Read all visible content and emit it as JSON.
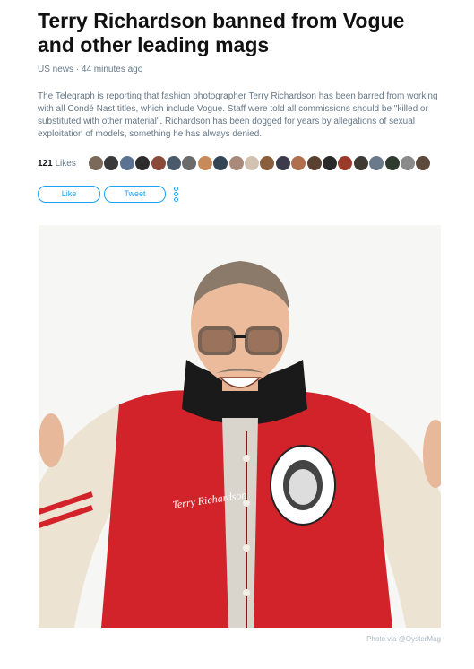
{
  "article": {
    "title": "Terry Richardson banned from Vogue and other leading mags",
    "meta": "US news · 44 minutes ago",
    "body": "The Telegraph is reporting that fashion photographer Terry Richardson has been barred from working with all Condé Nast titles, which include Vogue. Staff were told all commissions should be \"killed or substituted with other material\". Richardson has been dogged for years by allegations of sexual exploitation of models, something he has always denied.",
    "photo_caption": "Photo via @OysterMag",
    "photo_jacket_script": "Terry Richardson"
  },
  "likes": {
    "count": "121",
    "label": "Likes",
    "avatar_colors": [
      "#7b6a5a",
      "#3a3a3a",
      "#5b7390",
      "#2d2d2d",
      "#8a4b3a",
      "#4a5a6a",
      "#6b6b6b",
      "#c98a5a",
      "#334455",
      "#a98a7a",
      "#d2c2b2",
      "#8b5e3c",
      "#3b3b4b",
      "#b07050",
      "#5a4030",
      "#2a2a2a",
      "#9a3a2a",
      "#403a35",
      "#6a7a8a",
      "#2e3b2e",
      "#8a8a8a",
      "#5d4a3d"
    ]
  },
  "actions": {
    "like_label": "Like",
    "tweet_label": "Tweet"
  },
  "colors": {
    "accent": "#1da1f2",
    "muted": "#657786",
    "jacket": "#d2232a"
  },
  "icons": {
    "more": "more-vertical-icon"
  }
}
